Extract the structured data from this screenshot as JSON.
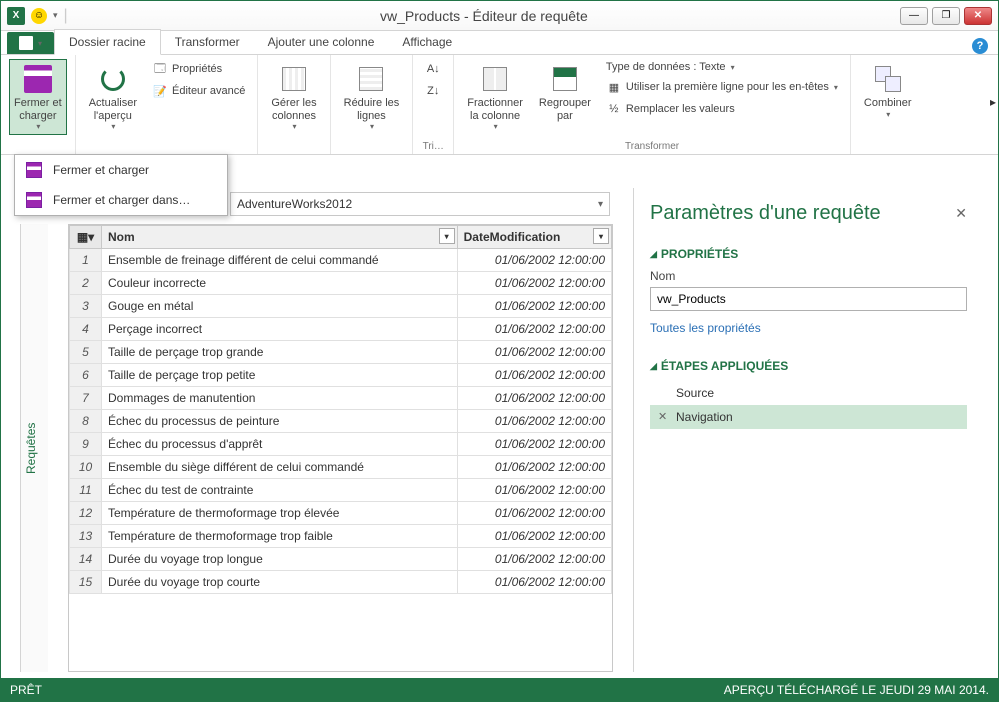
{
  "titlebar": {
    "title": "vw_Products - Éditeur de requête"
  },
  "tabs": {
    "file": "",
    "t1": "Dossier racine",
    "t2": "Transformer",
    "t3": "Ajouter une colonne",
    "t4": "Affichage"
  },
  "ribbon": {
    "close_load": "Fermer et\ncharger",
    "refresh": "Actualiser\nl'aperçu",
    "properties": "Propriétés",
    "advanced_editor": "Éditeur avancé",
    "manage_cols": "Gérer les\ncolonnes",
    "reduce_rows": "Réduire les\nlignes",
    "sort_group": "Tri…",
    "split": "Fractionner\nla colonne",
    "group_by": "Regrouper\npar",
    "datatype": "Type de données : Texte",
    "first_row": "Utiliser la première ligne pour les en-têtes",
    "replace": "Remplacer les valeurs",
    "transform_group": "Transformer",
    "combine": "Combiner"
  },
  "dropdown": {
    "item1": "Fermer et charger",
    "item2": "Fermer et charger dans…"
  },
  "source_bar": "AdventureWorks2012",
  "sidebar_label": "Requêtes",
  "table": {
    "col_nom": "Nom",
    "col_date": "DateModification",
    "rows": [
      {
        "n": "1",
        "nom": "Ensemble de freinage différent de celui commandé",
        "date": "01/06/2002 12:00:00"
      },
      {
        "n": "2",
        "nom": "Couleur incorrecte",
        "date": "01/06/2002 12:00:00"
      },
      {
        "n": "3",
        "nom": "Gouge en métal",
        "date": "01/06/2002 12:00:00"
      },
      {
        "n": "4",
        "nom": "Perçage incorrect",
        "date": "01/06/2002 12:00:00"
      },
      {
        "n": "5",
        "nom": "Taille de perçage trop grande",
        "date": "01/06/2002 12:00:00"
      },
      {
        "n": "6",
        "nom": "Taille de perçage trop petite",
        "date": "01/06/2002 12:00:00"
      },
      {
        "n": "7",
        "nom": "Dommages de manutention",
        "date": "01/06/2002 12:00:00"
      },
      {
        "n": "8",
        "nom": "Échec du processus de peinture",
        "date": "01/06/2002 12:00:00"
      },
      {
        "n": "9",
        "nom": "Échec du processus d'apprêt",
        "date": "01/06/2002 12:00:00"
      },
      {
        "n": "10",
        "nom": "Ensemble du siège différent de celui commandé",
        "date": "01/06/2002 12:00:00"
      },
      {
        "n": "11",
        "nom": "Échec du test de contrainte",
        "date": "01/06/2002 12:00:00"
      },
      {
        "n": "12",
        "nom": "Température de thermoformage trop élevée",
        "date": "01/06/2002 12:00:00"
      },
      {
        "n": "13",
        "nom": "Température de thermoformage trop faible",
        "date": "01/06/2002 12:00:00"
      },
      {
        "n": "14",
        "nom": "Durée du voyage trop longue",
        "date": "01/06/2002 12:00:00"
      },
      {
        "n": "15",
        "nom": "Durée du voyage trop courte",
        "date": "01/06/2002 12:00:00"
      }
    ]
  },
  "right_panel": {
    "title": "Paramètres d'une requête",
    "properties_head": "PROPRIÉTÉS",
    "name_label": "Nom",
    "name_value": "vw_Products",
    "all_props": "Toutes les propriétés",
    "steps_head": "ÉTAPES APPLIQUÉES",
    "step1": "Source",
    "step2": "Navigation"
  },
  "status": {
    "left": "PRÊT",
    "right": "APERÇU TÉLÉCHARGÉ LE JEUDI 29 MAI 2014."
  }
}
